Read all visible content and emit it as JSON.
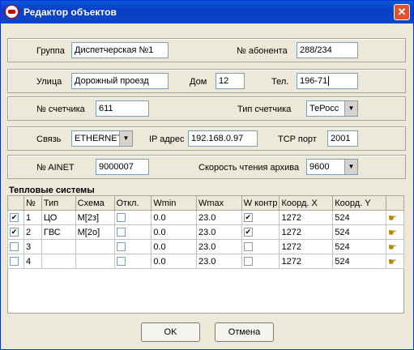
{
  "window": {
    "title": "Редактор объектов",
    "close_glyph": "✕"
  },
  "row1": {
    "group_label": "Группа",
    "group_value": "Диспетчерская №1",
    "subscriber_label": "№ абонента",
    "subscriber_value": "288/234"
  },
  "row2": {
    "street_label": "Улица",
    "street_value": "Дорожный проезд",
    "house_label": "Дом",
    "house_value": "12",
    "phone_label": "Тел.",
    "phone_value": "196-71"
  },
  "row3": {
    "meter_label": "№ счетчика",
    "meter_value": "611",
    "meter_type_label": "Тип счетчика",
    "meter_type_value": "ТеРосс"
  },
  "row4": {
    "link_label": "Связь",
    "link_value": "ETHERNET",
    "ip_label": "IP адрес",
    "ip_value": "192.168.0.97",
    "port_label": "TCP порт",
    "port_value": "2001"
  },
  "row5": {
    "ainet_label": "№ AINET",
    "ainet_value": "9000007",
    "speed_label": "Скорость чтения архива",
    "speed_value": "9600"
  },
  "systems": {
    "title": "Тепловые системы",
    "columns": [
      "№",
      "Тип",
      "Схема",
      "Откл.",
      "Wmin",
      "Wmax",
      "W контр",
      "Коорд. X",
      "Коорд. Y"
    ],
    "rows": [
      {
        "checked": true,
        "num": "1",
        "type": "ЦО",
        "scheme": "M[2з]",
        "off": false,
        "wmin": "0.0",
        "wmax": "23.0",
        "wctrl": true,
        "x": "1272",
        "y": "524"
      },
      {
        "checked": true,
        "num": "2",
        "type": "ГВС",
        "scheme": "M[2о]",
        "off": false,
        "wmin": "0.0",
        "wmax": "23.0",
        "wctrl": true,
        "x": "1272",
        "y": "524"
      },
      {
        "checked": false,
        "num": "3",
        "type": "",
        "scheme": "",
        "off": false,
        "wmin": "0.0",
        "wmax": "23.0",
        "wctrl": false,
        "x": "1272",
        "y": "524"
      },
      {
        "checked": false,
        "num": "4",
        "type": "",
        "scheme": "",
        "off": false,
        "wmin": "0.0",
        "wmax": "23.0",
        "wctrl": false,
        "x": "1272",
        "y": "524"
      }
    ]
  },
  "buttons": {
    "ok": "OK",
    "cancel": "Отмена"
  },
  "icons": {
    "row_action": "hand-pointer-icon"
  }
}
